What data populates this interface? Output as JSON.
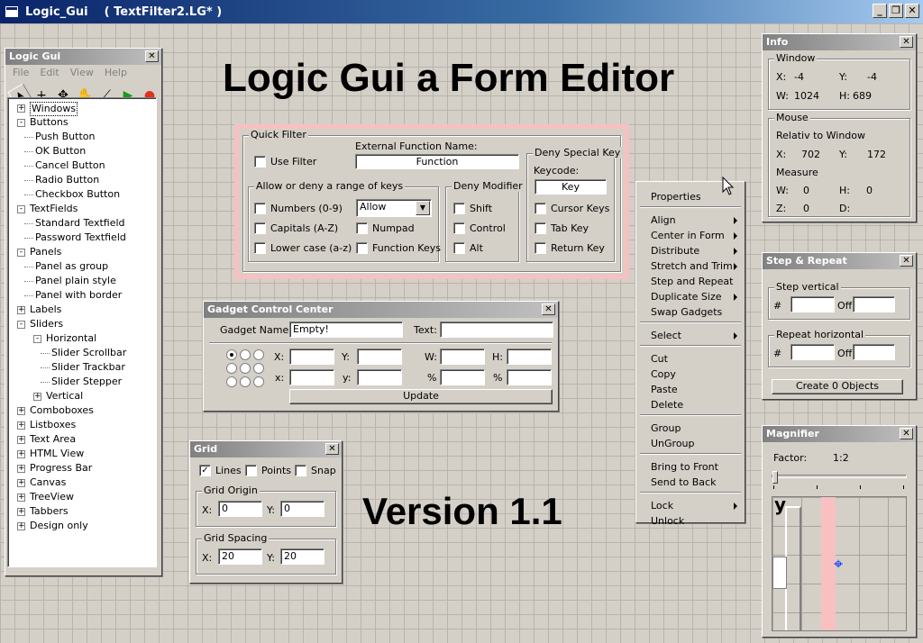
{
  "window": {
    "title": "Logic_Gui    ( TextFilter2.LG* )",
    "min": "_",
    "max": "❐",
    "close": "✕"
  },
  "canvas": {
    "heading": "Logic Gui a Form Editor",
    "version": "Version 1.1"
  },
  "logicgui": {
    "title": "Logic Gui",
    "menu": [
      "File",
      "Edit",
      "View",
      "Help"
    ],
    "tools": [
      "pointer-icon",
      "cross-icon",
      "move-icon",
      "hand-icon",
      "ruler-icon",
      "run-icon",
      "record-icon"
    ],
    "tree": [
      {
        "label": "Windows",
        "level": 0,
        "exp": "+"
      },
      {
        "label": "Buttons",
        "level": 0,
        "exp": "-"
      },
      {
        "label": "Push Button",
        "level": 1
      },
      {
        "label": "OK Button",
        "level": 1
      },
      {
        "label": "Cancel Button",
        "level": 1
      },
      {
        "label": "Radio Button",
        "level": 1
      },
      {
        "label": "Checkbox Button",
        "level": 1
      },
      {
        "label": "TextFields",
        "level": 0,
        "exp": "-"
      },
      {
        "label": "Standard Textfield",
        "level": 1
      },
      {
        "label": "Password Textfield",
        "level": 1
      },
      {
        "label": "Panels",
        "level": 0,
        "exp": "-"
      },
      {
        "label": "Panel as group",
        "level": 1
      },
      {
        "label": "Panel plain style",
        "level": 1
      },
      {
        "label": "Panel with border",
        "level": 1
      },
      {
        "label": "Labels",
        "level": 0,
        "exp": "+"
      },
      {
        "label": "Sliders",
        "level": 0,
        "exp": "-"
      },
      {
        "label": "Horizontal",
        "level": 1,
        "exp": "-"
      },
      {
        "label": "Slider Scrollbar",
        "level": 2
      },
      {
        "label": "Slider Trackbar",
        "level": 2
      },
      {
        "label": "Slider Stepper",
        "level": 2
      },
      {
        "label": "Vertical",
        "level": 1,
        "exp": "+"
      },
      {
        "label": "Comboboxes",
        "level": 0,
        "exp": "+"
      },
      {
        "label": "Listboxes",
        "level": 0,
        "exp": "+"
      },
      {
        "label": "Text Area",
        "level": 0,
        "exp": "+"
      },
      {
        "label": "HTML View",
        "level": 0,
        "exp": "+"
      },
      {
        "label": "Progress Bar",
        "level": 0,
        "exp": "+"
      },
      {
        "label": "Canvas",
        "level": 0,
        "exp": "+"
      },
      {
        "label": "TreeView",
        "level": 0,
        "exp": "+"
      },
      {
        "label": "Tabbers",
        "level": 0,
        "exp": "+"
      },
      {
        "label": "Design only",
        "level": 0,
        "exp": "+"
      }
    ]
  },
  "form": {
    "quick_filter": "Quick Filter",
    "use_filter": "Use Filter",
    "ext_fn_label": "External Function Name:",
    "ext_fn_value": "Function",
    "range_group": "Allow or deny a range of keys",
    "numbers": "Numbers (0-9)",
    "capitals": "Capitals (A-Z)",
    "lowercase": "Lower case (a-z)",
    "allow_select": "Allow",
    "numpad": "Numpad",
    "function_keys": "Function Keys",
    "deny_modifier": "Deny Modifier",
    "shift": "Shift",
    "control": "Control",
    "alt": "Alt",
    "deny_special": "Deny Special Key",
    "keycode": "Keycode:",
    "key_value": "Key",
    "cursor_keys": "Cursor Keys",
    "tab_key": "Tab Key",
    "return_key": "Return Key"
  },
  "gadget": {
    "title": "Gadget Control Center",
    "name_label": "Gadget Name:",
    "name_value": "Empty!",
    "text_label": "Text:",
    "X": "X:",
    "Y": "Y:",
    "W": "W:",
    "H": "H:",
    "x": "x:",
    "y": "y:",
    "pct": "%",
    "update": "Update"
  },
  "grid": {
    "title": "Grid",
    "lines": "Lines",
    "points": "Points",
    "snap": "Snap",
    "origin": "Grid Origin",
    "spacing": "Grid Spacing",
    "x": "X:",
    "y": "Y:",
    "origin_x": "0",
    "origin_y": "0",
    "spacing_x": "20",
    "spacing_y": "20"
  },
  "context_menu": {
    "items": [
      {
        "label": "Properties",
        "sub": false
      },
      {
        "label": "Align",
        "sub": true
      },
      {
        "label": "Center in Form",
        "sub": true
      },
      {
        "label": "Distribute",
        "sub": true
      },
      {
        "label": "Stretch and Trim",
        "sub": true
      },
      {
        "label": "Step and Repeat",
        "sub": false
      },
      {
        "label": "Duplicate Size",
        "sub": true
      },
      {
        "label": "Swap Gadgets",
        "sub": false
      },
      {
        "label": "Select",
        "sub": true
      },
      {
        "label": "Cut",
        "sub": false
      },
      {
        "label": "Copy",
        "sub": false
      },
      {
        "label": "Paste",
        "sub": false
      },
      {
        "label": "Delete",
        "sub": false
      },
      {
        "label": "Group",
        "sub": false
      },
      {
        "label": "UnGroup",
        "sub": false
      },
      {
        "label": "Bring to Front",
        "sub": false
      },
      {
        "label": "Send to Back",
        "sub": false
      },
      {
        "label": "Lock",
        "sub": true
      },
      {
        "label": "Unlock",
        "sub": false
      }
    ]
  },
  "info": {
    "title": "Info",
    "window": "Window",
    "X": "X:",
    "Y": "Y:",
    "W": "W:",
    "H": "H:",
    "Z": "Z:",
    "D": "D:",
    "win_x": "-4",
    "win_y": "-4",
    "win_w": "1024",
    "win_h": "689",
    "mouse": "Mouse",
    "relativ": "Relativ to Window",
    "mouse_x": "702",
    "mouse_y": "172",
    "measure": "Measure",
    "m_w": "0",
    "m_h": "0",
    "m_z": "0"
  },
  "step": {
    "title": "Step & Repeat",
    "vertical": "Step vertical",
    "horizontal": "Repeat horizontal",
    "hash": "#",
    "off": "Off",
    "create": "Create 0 Objects"
  },
  "magnifier": {
    "title": "Magnifier",
    "factor_label": "Factor:",
    "factor": "1:2",
    "slider_pct": 0
  }
}
